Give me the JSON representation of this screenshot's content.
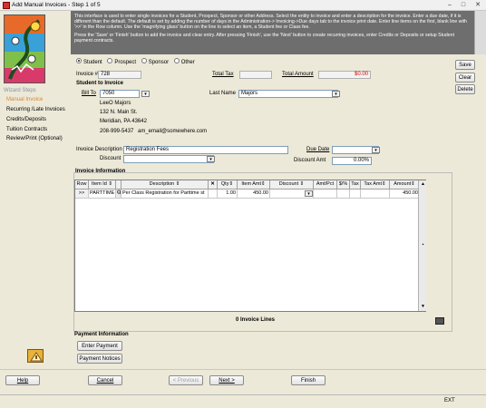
{
  "window": {
    "title": "Add Manual Invoices - Step 1 of 5"
  },
  "info_text": "This interface is used to enter single invoices for a Student, Prospect, Sponsor or other Address. Select the entity to invoice and enter a description for the invoice. Enter a due date, if it is different than the default. The default is set by adding the number of days in the Administration-> Invoicing->Due days tab to the invoice print date. Enter line items on the first, blank line with '>>' in the Row column. Use the 'magnifying glass' button on the line to select an item, a Student fee or Class fee.",
  "info_text2": "Press the 'Save' or 'Finish' button to add the invoice and clear entry. After pressing 'Finish', use the 'Next' button to create recurring invoices, enter Credits or Deposits or setup Student payment contracts.",
  "wizard": {
    "title": "Wizard Steps",
    "steps": [
      {
        "label": "Manual Invoice",
        "active": true
      },
      {
        "label": "Recurring /Late Invoices",
        "active": false
      },
      {
        "label": "Credits/Deposits",
        "active": false
      },
      {
        "label": "Tuition Contracts",
        "active": false
      },
      {
        "label": "Review/Print (Optional)",
        "active": false
      }
    ]
  },
  "entity_types": [
    "Student",
    "Prospect",
    "Sponsor",
    "Other"
  ],
  "entity_selected": "Student",
  "side_buttons": {
    "save": "Save",
    "clear": "Clear",
    "delete": "Delete"
  },
  "header": {
    "invoice_label": "Invoice #",
    "invoice_no": "728",
    "total_tax_label": "Total Tax",
    "total_tax": "",
    "total_amount_label": "Total Amount",
    "total_amount": "$0.00",
    "accent_red": "#cc0000"
  },
  "student": {
    "section_title": "Student to Invoice",
    "bill_to_label": "Bill To",
    "bill_to": "7050",
    "last_name_label": "Last Name",
    "last_name": "Majors",
    "address": [
      "LeeO Majors",
      "132 N. Main St.",
      "Meridian, PA  43642"
    ],
    "phone": "208-999-5437",
    "email": "am_email@somewhere.com"
  },
  "description": {
    "invoice_desc_label": "Invoice Description",
    "invoice_desc": "Registration Fees",
    "due_date_label": "Due Date",
    "due_date": "",
    "discount_label": "Discount",
    "discount": "",
    "discount_amt_label": "Discount Amt",
    "discount_amt": "0.00%"
  },
  "invoice_info": {
    "title": "Invoice Information",
    "columns": [
      "Row",
      "Item Id",
      "",
      "Description",
      "",
      "Qty",
      "Item Amt",
      "Discount",
      "Amt/Pct",
      "$/%",
      "Tax",
      "Tax Amt",
      "Amount"
    ],
    "rows": [
      {
        "row": ">>",
        "item_id": "PARTTIME",
        "description": "Per Class Registration for Parttime st",
        "qty": "1.00",
        "item_amt": "450.00",
        "discount": "",
        "amt_pct": "",
        "dollar_pct": "",
        "tax": "",
        "tax_amt": "",
        "amount": "450.00"
      }
    ],
    "line_count": "0 Invoice Lines"
  },
  "payment": {
    "title": "Payment Information",
    "enter_payment": "Enter Payment",
    "payment_notices": "Payment Notices"
  },
  "nav": {
    "help": "Help",
    "cancel": "Cancel",
    "previous": "< Previous",
    "next": "Next >",
    "finish": "Finish"
  },
  "status": {
    "ext": "EXT"
  }
}
